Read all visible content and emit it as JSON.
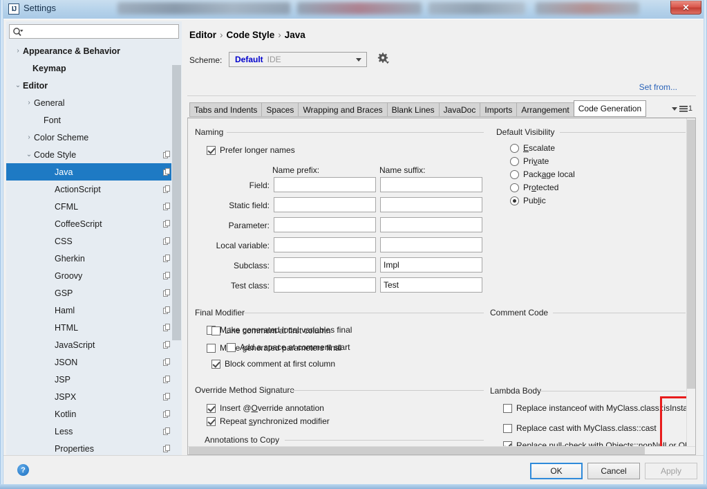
{
  "window": {
    "title": "Settings",
    "app_icon": "IJ",
    "close_label": "✕"
  },
  "search": {
    "value": "",
    "placeholder": ""
  },
  "sidebar": {
    "items": [
      {
        "label": "Appearance & Behavior",
        "arrow": "›",
        "indent": 10,
        "bold": true,
        "copy": false,
        "selected": false
      },
      {
        "label": "Keymap",
        "arrow": "",
        "indent": 24,
        "bold": true,
        "copy": false,
        "selected": false
      },
      {
        "label": "Editor",
        "arrow": "⌄",
        "indent": 10,
        "bold": true,
        "copy": false,
        "selected": false
      },
      {
        "label": "General",
        "arrow": "›",
        "indent": 26,
        "bold": false,
        "copy": false,
        "selected": false
      },
      {
        "label": "Font",
        "arrow": "",
        "indent": 40,
        "bold": false,
        "copy": false,
        "selected": false
      },
      {
        "label": "Color Scheme",
        "arrow": "›",
        "indent": 26,
        "bold": false,
        "copy": false,
        "selected": false
      },
      {
        "label": "Code Style",
        "arrow": "⌄",
        "indent": 26,
        "bold": false,
        "copy": true,
        "selected": false
      },
      {
        "label": "Java",
        "arrow": "",
        "indent": 56,
        "bold": false,
        "copy": true,
        "selected": true
      },
      {
        "label": "ActionScript",
        "arrow": "",
        "indent": 56,
        "bold": false,
        "copy": true,
        "selected": false
      },
      {
        "label": "CFML",
        "arrow": "",
        "indent": 56,
        "bold": false,
        "copy": true,
        "selected": false
      },
      {
        "label": "CoffeeScript",
        "arrow": "",
        "indent": 56,
        "bold": false,
        "copy": true,
        "selected": false
      },
      {
        "label": "CSS",
        "arrow": "",
        "indent": 56,
        "bold": false,
        "copy": true,
        "selected": false
      },
      {
        "label": "Gherkin",
        "arrow": "",
        "indent": 56,
        "bold": false,
        "copy": true,
        "selected": false
      },
      {
        "label": "Groovy",
        "arrow": "",
        "indent": 56,
        "bold": false,
        "copy": true,
        "selected": false
      },
      {
        "label": "GSP",
        "arrow": "",
        "indent": 56,
        "bold": false,
        "copy": true,
        "selected": false
      },
      {
        "label": "Haml",
        "arrow": "",
        "indent": 56,
        "bold": false,
        "copy": true,
        "selected": false
      },
      {
        "label": "HTML",
        "arrow": "",
        "indent": 56,
        "bold": false,
        "copy": true,
        "selected": false
      },
      {
        "label": "JavaScript",
        "arrow": "",
        "indent": 56,
        "bold": false,
        "copy": true,
        "selected": false
      },
      {
        "label": "JSON",
        "arrow": "",
        "indent": 56,
        "bold": false,
        "copy": true,
        "selected": false
      },
      {
        "label": "JSP",
        "arrow": "",
        "indent": 56,
        "bold": false,
        "copy": true,
        "selected": false
      },
      {
        "label": "JSPX",
        "arrow": "",
        "indent": 56,
        "bold": false,
        "copy": true,
        "selected": false
      },
      {
        "label": "Kotlin",
        "arrow": "",
        "indent": 56,
        "bold": false,
        "copy": true,
        "selected": false
      },
      {
        "label": "Less",
        "arrow": "",
        "indent": 56,
        "bold": false,
        "copy": true,
        "selected": false
      },
      {
        "label": "Properties",
        "arrow": "",
        "indent": 56,
        "bold": false,
        "copy": true,
        "selected": false
      }
    ]
  },
  "breadcrumb": {
    "part1": "Editor",
    "sep1": "›",
    "part2": "Code Style",
    "sep2": "›",
    "part3": "Java"
  },
  "scheme": {
    "label": "Scheme:",
    "value_primary": "Default",
    "value_secondary": "IDE",
    "gear_icon": "gear-icon",
    "set_from_link": "Set from..."
  },
  "tabs": {
    "items": [
      {
        "label": "Tabs and Indents",
        "active": false
      },
      {
        "label": "Spaces",
        "active": false
      },
      {
        "label": "Wrapping and Braces",
        "active": false
      },
      {
        "label": "Blank Lines",
        "active": false
      },
      {
        "label": "JavaDoc",
        "active": false
      },
      {
        "label": "Imports",
        "active": false
      },
      {
        "label": "Arrangement",
        "active": false
      },
      {
        "label": "Code Generation",
        "active": true
      }
    ],
    "overflow_count": "1"
  },
  "naming": {
    "group_title": "Naming",
    "prefer_longer_names": {
      "label": "Prefer longer names",
      "checked": true
    },
    "col_prefix": "Name prefix:",
    "col_suffix": "Name suffix:",
    "rows": [
      {
        "label": "Field:",
        "prefix": "",
        "suffix": ""
      },
      {
        "label": "Static field:",
        "prefix": "",
        "suffix": ""
      },
      {
        "label": "Parameter:",
        "prefix": "",
        "suffix": ""
      },
      {
        "label": "Local variable:",
        "prefix": "",
        "suffix": ""
      },
      {
        "label": "Subclass:",
        "prefix": "",
        "suffix": "Impl"
      },
      {
        "label": "Test class:",
        "prefix": "",
        "suffix": "Test"
      }
    ]
  },
  "default_visibility": {
    "group_title": "Default Visibility",
    "options": [
      {
        "label": "Escalate",
        "mn": 0,
        "selected": false
      },
      {
        "label": "Private",
        "mn": 3,
        "selected": false
      },
      {
        "label": "Package local",
        "mn": 4,
        "selected": false
      },
      {
        "label": "Protected",
        "mn": 2,
        "selected": false
      },
      {
        "label": "Public",
        "mn": 3,
        "selected": true
      }
    ]
  },
  "final_modifier": {
    "group_title": "Final Modifier",
    "options": [
      {
        "label": "Make generated local variables final",
        "checked": false
      },
      {
        "label": "Make generated parameters final",
        "checked": false
      }
    ]
  },
  "override_method_signature": {
    "group_title": "Override Method Signature",
    "options": [
      {
        "label": "Insert @Override annotation",
        "mn": 8,
        "checked": true
      },
      {
        "label": "Repeat synchronized modifier",
        "mn": 7,
        "checked": true
      }
    ],
    "annotations_group_title": "Annotations to Copy",
    "add_button": "+",
    "remove_button": "−",
    "list_items": []
  },
  "comment_code": {
    "group_title": "Comment Code",
    "highlight_color": "#e81c1c",
    "options": [
      {
        "label": "Line comment at first column",
        "checked": false,
        "indent": 34
      },
      {
        "label": "Add a space at comment start",
        "checked": false,
        "indent": 56
      },
      {
        "label": "Block comment at first column",
        "checked": true,
        "indent": 34
      }
    ]
  },
  "lambda_body": {
    "group_title": "Lambda Body",
    "options": [
      {
        "label": "Replace instanceof with MyClass.class::isInstance",
        "checked": false
      },
      {
        "label": "Replace cast with MyClass.class::cast",
        "checked": false
      },
      {
        "label": "Replace null-check with Objects::nonNull or Objects::isNull",
        "checked": true
      }
    ]
  },
  "footer": {
    "help_icon": "?",
    "ok": "OK",
    "cancel": "Cancel",
    "apply": "Apply"
  }
}
